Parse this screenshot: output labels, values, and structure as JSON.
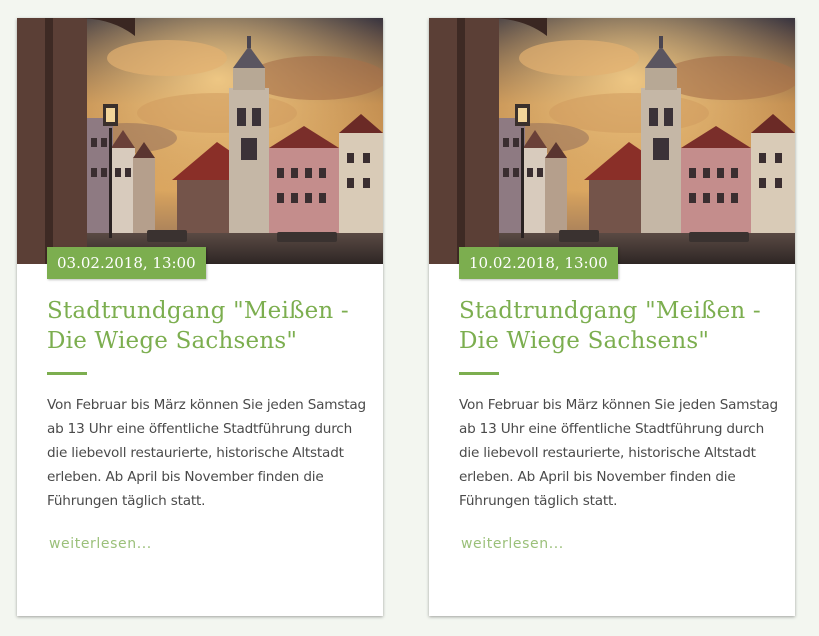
{
  "events": [
    {
      "date": "03.02.2018, 13:00",
      "title": "Stadtrundgang \"Meißen - Die Wiege Sachsens\"",
      "excerpt": "Von Februar bis März können Sie jeden Samstag ab 13 Uhr eine öffentliche Stadtführung durch die liebevoll restaurierte, historische Altstadt erleben. Ab April bis November finden die Führungen täglich statt.",
      "read_more": "weiterlesen...",
      "image": "meissen-marketplace-photo"
    },
    {
      "date": "10.02.2018, 13:00",
      "title": "Stadtrundgang \"Meißen - Die Wiege Sachsens\"",
      "excerpt": "Von Februar bis März können Sie jeden Samstag ab 13 Uhr eine öffentliche Stadtführung durch die liebevoll restaurierte, historische Altstadt erleben. Ab April bis November finden die Führungen täglich statt.",
      "read_more": "weiterlesen...",
      "image": "meissen-marketplace-photo"
    }
  ],
  "colors": {
    "accent": "#7cae4f",
    "link": "#9bc07a",
    "text": "#4a4a4a",
    "background": "#f3f6f0",
    "card": "#ffffff"
  }
}
